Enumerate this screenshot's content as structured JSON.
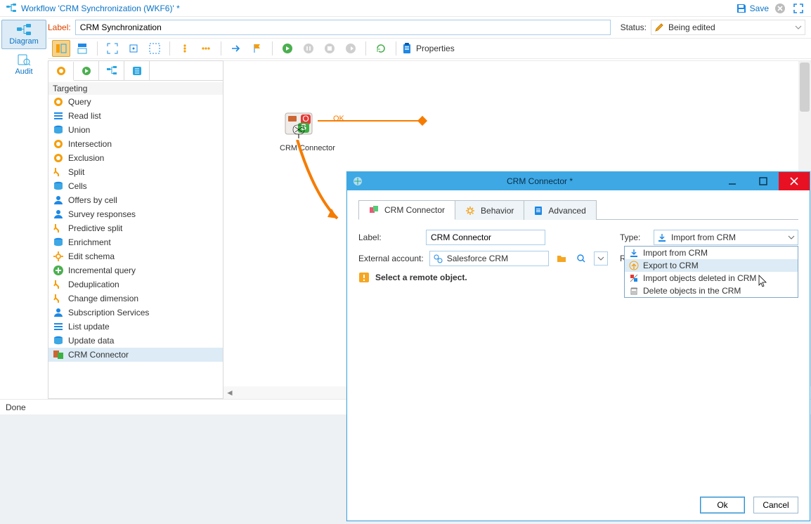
{
  "title_bar": {
    "title": "Workflow 'CRM Synchronization (WKF6)' *",
    "save_label": "Save"
  },
  "form": {
    "label_caption": "Label:",
    "label_value": "CRM Synchronization",
    "status_caption": "Status:",
    "status_value": "Being edited"
  },
  "rail": {
    "diagram": "Diagram",
    "audit": "Audit"
  },
  "toolbar": {
    "properties_label": "Properties"
  },
  "palette": {
    "group": "Targeting",
    "items": [
      "Query",
      "Read list",
      "Union",
      "Intersection",
      "Exclusion",
      "Split",
      "Cells",
      "Offers by cell",
      "Survey responses",
      "Predictive split",
      "Enrichment",
      "Edit schema",
      "Incremental query",
      "Deduplication",
      "Change dimension",
      "Subscription Services",
      "List update",
      "Update data",
      "CRM Connector"
    ],
    "selected_index": 18
  },
  "canvas": {
    "node_label": "CRM Connector",
    "edge_label": "OK"
  },
  "status_bar": {
    "text": "Done"
  },
  "dialog": {
    "title": "CRM Connector *",
    "tabs": {
      "t1": "CRM Connector",
      "t2": "Behavior",
      "t3": "Advanced"
    },
    "labels": {
      "label": "Label:",
      "type": "Type:",
      "external_account": "External account:",
      "remote_object": "Remote object:"
    },
    "values": {
      "label": "CRM Connector",
      "external_account": "Salesforce CRM",
      "type_selected": "Import from CRM"
    },
    "type_options": [
      "Import from CRM",
      "Export to CRM",
      "Import objects deleted in CRM",
      "Delete objects in the CRM"
    ],
    "type_highlight_index": 1,
    "warning": "Select a remote object.",
    "buttons": {
      "ok": "Ok",
      "cancel": "Cancel"
    }
  }
}
